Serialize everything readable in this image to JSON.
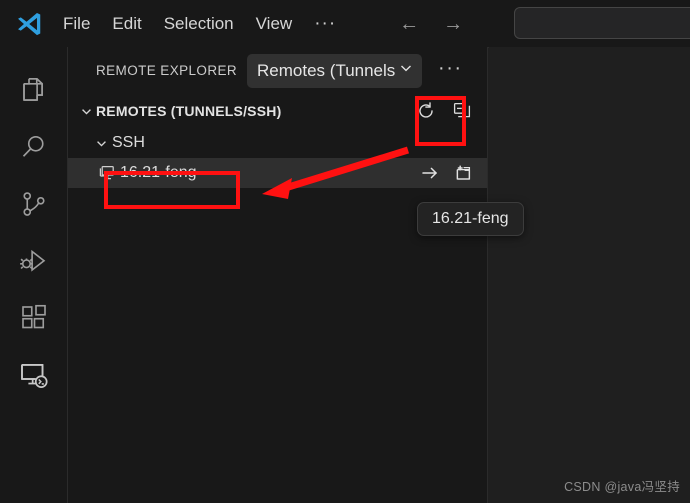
{
  "titlebar": {
    "logo_icon": "vscode-logo",
    "menu": [
      {
        "label": "File"
      },
      {
        "label": "Edit"
      },
      {
        "label": "Selection"
      },
      {
        "label": "View"
      },
      {
        "label": "···"
      }
    ],
    "nav": {
      "back_icon": "arrow-left-icon",
      "back_glyph": "←",
      "forward_icon": "arrow-right-icon",
      "forward_glyph": "→"
    },
    "command_bar": {
      "value": "",
      "placeholder": ""
    }
  },
  "activitybar": {
    "items": [
      {
        "icon": "explorer-files-icon",
        "label": "Explorer"
      },
      {
        "icon": "search-icon",
        "label": "Search"
      },
      {
        "icon": "source-control-branch-icon",
        "label": "Source Control"
      },
      {
        "icon": "run-and-debug-icon",
        "label": "Run and Debug"
      },
      {
        "icon": "extensions-blocks-icon",
        "label": "Extensions"
      },
      {
        "icon": "remote-explorer-monitor-icon",
        "label": "Remote Explorer"
      }
    ]
  },
  "sidebar": {
    "title": "REMOTE EXPLORER",
    "dropdown": {
      "label": "Remotes (Tunnels",
      "chevron_icon": "chevron-down-icon"
    },
    "more_actions": {
      "label": "···",
      "icon": "more-actions-icon"
    },
    "section": {
      "title": "REMOTES (TUNNELS/SSH)",
      "twisty_icon": "chevron-down-icon",
      "actions": [
        {
          "icon": "refresh-icon",
          "label": "Refresh"
        },
        {
          "icon": "collapse-all-icon",
          "label": "Collapse All"
        }
      ]
    },
    "tree": [
      {
        "label": "SSH",
        "twisty_icon": "chevron-down-icon",
        "level": 1,
        "selected": false
      },
      {
        "label": "16.21-feng",
        "icon": "vm-monitor-icon",
        "level": 2,
        "selected": true,
        "actions": [
          {
            "icon": "connect-arrow-icon",
            "label": "Connect in Current Window",
            "glyph": "→"
          },
          {
            "icon": "connect-new-window-icon",
            "label": "Connect in New Window"
          }
        ]
      }
    ]
  },
  "tooltip": {
    "text": "16.21-feng"
  },
  "annotations": {
    "box_refresh": {
      "target": "refresh-icon",
      "color": "#ff1111"
    },
    "box_tree_item": {
      "target": "16.21-feng",
      "color": "#ff1111"
    },
    "arrow": {
      "color": "#ff1111",
      "from": "refresh-icon",
      "to": "16.21-feng"
    }
  },
  "watermark": {
    "text": "CSDN @java冯坚持"
  },
  "colors": {
    "titlebar_bg": "#181818",
    "activitybar_bg": "#181818",
    "sidebar_bg": "#181818",
    "editor_bg": "#1f1f1f",
    "selection_bg": "#2f2f2f",
    "dropdown_bg": "#313131",
    "text": "#cccccc",
    "accent_red": "#ff1111",
    "logo_blue": "#2f9fdf"
  }
}
